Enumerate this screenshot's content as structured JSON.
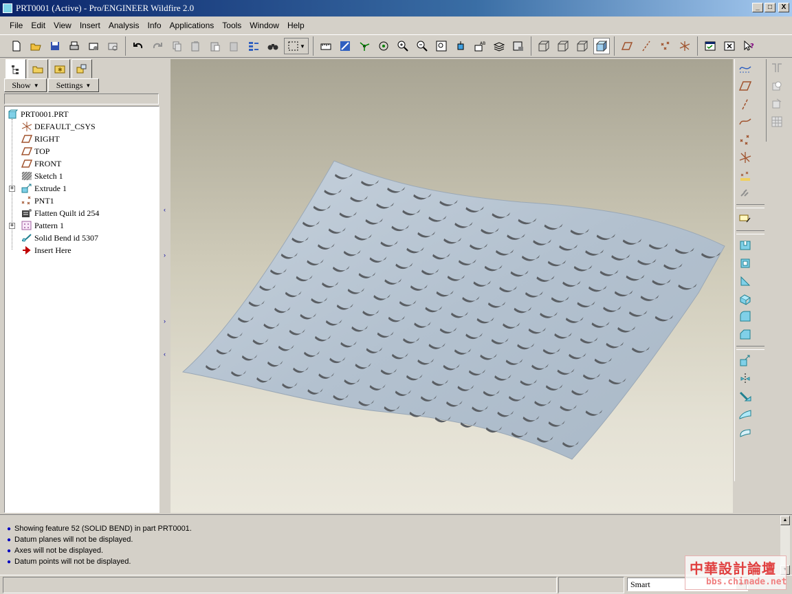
{
  "window": {
    "title": "PRT0001 (Active) - Pro/ENGINEER Wildfire 2.0",
    "buttons": [
      "_",
      "□",
      "X"
    ]
  },
  "menu": [
    "File",
    "Edit",
    "View",
    "Insert",
    "Analysis",
    "Info",
    "Applications",
    "Tools",
    "Window",
    "Help"
  ],
  "toolbar": {
    "groups": [
      [
        "new-icon",
        "open-icon",
        "save-icon",
        "print-icon",
        "send-mail-icon",
        "send-link-icon"
      ],
      [
        "undo-icon",
        "redo-icon",
        "cut-icon",
        "copy-icon",
        "paste-icon",
        "paste-special-icon",
        "regenerate-icon",
        "find-icon",
        "select-box-icon"
      ],
      [
        "repaint-icon",
        "spin-center-icon",
        "orient-mode-icon",
        "saved-views-icon",
        "zoom-in-icon",
        "zoom-out-icon",
        "refit-icon",
        "reorient-icon",
        "view-manager-icon",
        "layers-icon",
        "model-display-icon"
      ],
      [
        "wireframe-icon",
        "hidden-line-icon",
        "no-hidden-icon",
        "shading-icon"
      ],
      [
        "datum-plane-toggle-icon",
        "datum-axis-toggle-icon",
        "datum-point-toggle-icon",
        "csys-toggle-icon"
      ],
      [
        "window-activate-icon",
        "window-close-icon",
        "context-help-icon"
      ]
    ]
  },
  "navigator": {
    "tabs": [
      "model-tree-tab",
      "folder-browser-tab",
      "favorites-tab",
      "connections-tab"
    ],
    "show_label": "Show",
    "settings_label": "Settings",
    "tree": [
      {
        "label": "PRT0001.PRT",
        "icon": "part-icon",
        "root": true
      },
      {
        "label": "DEFAULT_CSYS",
        "icon": "csys-icon"
      },
      {
        "label": "RIGHT",
        "icon": "datum-plane-icon"
      },
      {
        "label": "TOP",
        "icon": "datum-plane-icon"
      },
      {
        "label": "FRONT",
        "icon": "datum-plane-icon"
      },
      {
        "label": "Sketch 1",
        "icon": "sketch-icon"
      },
      {
        "label": "Extrude 1",
        "icon": "extrude-icon",
        "expandable": true
      },
      {
        "label": "PNT1",
        "icon": "datum-point-icon"
      },
      {
        "label": "Flatten Quilt id 254",
        "icon": "flatten-quilt-icon"
      },
      {
        "label": "Pattern 1",
        "icon": "pattern-icon",
        "expandable": true
      },
      {
        "label": "Solid Bend id 5307",
        "icon": "solid-bend-icon"
      },
      {
        "label": "Insert Here",
        "icon": "insert-here-icon"
      }
    ]
  },
  "right_toolbar": [
    "sketch-datum-curve-icon",
    "datum-plane-tool-icon",
    "datum-axis-tool-icon",
    "datum-curve-tool-icon",
    "datum-point-tool-icon",
    "csys-tool-icon",
    "analysis-feature-icon",
    "insert-feature-icon",
    "annotation-icon",
    "extrude-tool-icon",
    "revolve-tool-icon",
    "rib-tool-icon",
    "shell-tool-icon",
    "round-tool-icon",
    "chamfer-tool-icon",
    "copy-feature-icon",
    "mirror-tool-icon",
    "merge-tool-icon",
    "trim-tool-icon",
    "pattern-tool-icon"
  ],
  "right_toolbar2": [
    "draft-tool-icon",
    "hole-tool-icon",
    "offset-tool-icon",
    "thicken-tool-icon"
  ],
  "messages": [
    "Showing feature 52 (SOLID BEND) in part PRT0001.",
    "Datum planes will not be displayed.",
    "Axes will not be displayed.",
    "Datum points will not be displayed."
  ],
  "status": {
    "filter_value": "Smart"
  },
  "watermark": {
    "text": "中華設計論壇",
    "url": "bbs.chinade.net"
  },
  "colors": {
    "surface": "#b9c6d3",
    "slot": "#5a5e63",
    "title_bar": "#0a246a"
  }
}
